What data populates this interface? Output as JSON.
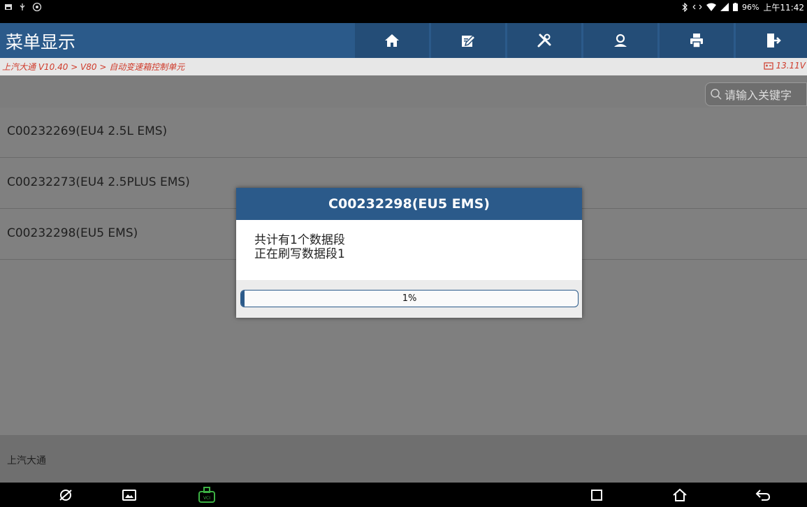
{
  "statusbar": {
    "battery": "96%",
    "time": "上午11:42"
  },
  "header": {
    "title": "菜单显示",
    "tools": [
      "home-icon",
      "edit-icon",
      "tools-icon",
      "user-icon",
      "print-icon",
      "exit-icon"
    ]
  },
  "breadcrumb": {
    "path": "上汽大通 V10.40 > V80 > 自动变速箱控制单元",
    "voltage": "13.11V"
  },
  "search": {
    "placeholder": "请输入关键字"
  },
  "list": {
    "items": [
      {
        "label": "C00232269(EU4 2.5L EMS)"
      },
      {
        "label": "C00232273(EU4 2.5PLUS EMS)"
      },
      {
        "label": "C00232298(EU5 EMS)"
      }
    ]
  },
  "footer": {
    "brand": "上汽大通"
  },
  "dialog": {
    "title": "C00232298(EU5 EMS)",
    "line1": "共计有1个数据段",
    "line2": "正在刷写数据段1",
    "progress_text": "1%",
    "progress_value": 0.01
  },
  "colors": {
    "accent": "#2b5a8a",
    "breadcrumb": "#cf3a2a",
    "vci_green": "#3cb043"
  }
}
